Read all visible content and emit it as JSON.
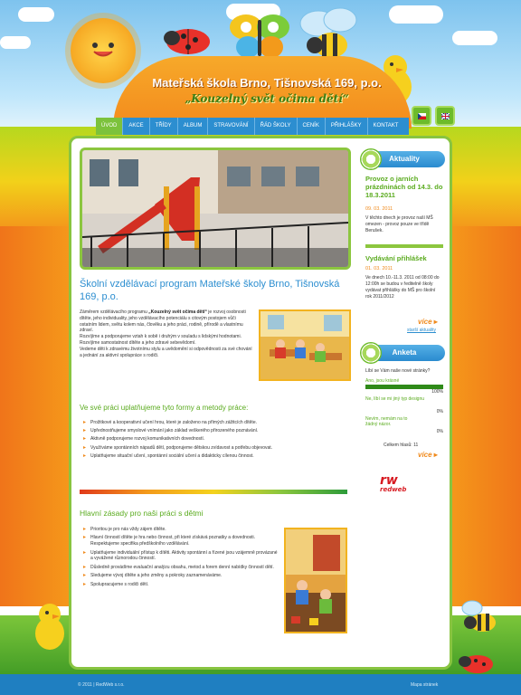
{
  "header": {
    "title": "Mateřská škola Brno, Tišnovská 169, p.o.",
    "motto": "„Kouzelný svět očima dětí“"
  },
  "nav": {
    "items": [
      "ÚVOD",
      "AKCE",
      "TŘÍDY",
      "ALBUM",
      "STRAVOVÁNÍ",
      "ŘÁD ŠKOLY",
      "CENÍK",
      "PŘIHLÁŠKY",
      "KONTAKT"
    ],
    "active": "ÚVOD"
  },
  "main": {
    "heading": "Školní vzdělávací program Mateřské školy Brno, Tišnovská 169, p.o.",
    "intro": {
      "lead": "Záměrem vzdělávacího programu ",
      "program": "„Kouzelný svět očima dětí“",
      "rest": " je rozvoj osobnosti dítěte, jeho individuality, jeho vzdělávacího potenciálu s citovým postojem vůči ostatním lidem, světu kolem nás, člověku a jeho práci, rodině, přírodě a vlastnímu zdraví.",
      "lines": [
        "Rozvíjíme a podporujeme vztah k sobě i druhým v souladu s lidskými hodnotami.",
        "Rozvíjíme samostatnost dítěte a jeho zdravé sebevědomí.",
        "Vedeme děti k zdravému životnímu stylu a uvědomění si odpovědnosti za své chování a jednání za aktivní spolupráce s rodiči."
      ]
    },
    "methods": {
      "heading": "Ve své práci uplatňujeme tyto formy a metody práce:",
      "items": [
        "Prožitkové a kooperativní učení hrou, které je založeno na přímých zážitcích dítěte.",
        "Upřednostňujeme smyslové vnímání jako základ veškerého přirozeného poznávání.",
        "Aktivně podporujeme rozvoj komunikativních dovedností.",
        "Využíváme spontánních nápadů dětí, podporujeme dětskou zvídavost a potřebu objevovat.",
        "Uplatňujeme situační učení, spontánní sociální učení a didakticky cílenou činnost."
      ]
    },
    "principles": {
      "heading": "Hlavní zásady pro naši práci s dětmi",
      "items": [
        "Prioritou je pro nás vždy zájem dítěte.",
        "Hlavní činností dítěte je hra nebo činnost, při které získává poznatky a dovednosti. Respektujeme specifika předškolního vzdělávání.",
        "Uplatňujeme individuální přístup k dítěti. Aktivity spontánní a řízené jsou vzájemně provázané a vyvážené různorodou činností.",
        "Důsledně provádíme evaluační analýzu obsahu, metod a forem denní nabídky činností dětí.",
        "Sledujeme vývoj dítěte a jeho změny a pokroky zaznamenáváme.",
        "Spolupracujeme s rodiči dětí."
      ]
    }
  },
  "sidebar": {
    "news_heading": "Aktuality",
    "news": [
      {
        "title": "Provoz o jarních prázdninách od 14.3. do 18.3.2011",
        "date": "09. 03. 2011",
        "text": "V těchto dnech je provoz naší MŠ omezen - provoz pouze ve třídě Berušek."
      },
      {
        "title": "Vydávání přihlášek",
        "date": "01. 03. 2011",
        "text": "Ve dnech 10.-11.3. 2011 od 08:00 do 12:00h se budou v ředitelně školy vydávat přihlášky do MŠ pro školní rok 2011/2012"
      }
    ],
    "more_label": "více",
    "archive_label": "starší aktuality",
    "poll_heading": "Anketa",
    "poll": {
      "question": "Líbí se Vám naše nové stránky?",
      "options": [
        {
          "label": "Ano, jsou krásné",
          "percent_label": "100%",
          "percent": 100
        },
        {
          "label": "Ne, líbí se mi jiný typ designu",
          "percent_label": "0%",
          "percent": 0
        },
        {
          "label": "Nevím, nemám na to žádný názor.",
          "percent_label": "0%",
          "percent": 0
        }
      ],
      "total_label": "Celkem hlasů: 11"
    },
    "poll_more_label": "více",
    "partner_logo": {
      "mark": "rw",
      "word": "redweb"
    }
  },
  "footer": {
    "copyright": "© 2011 | RedWeb s.r.o.",
    "sitemap": "Mapa stránek"
  },
  "icons": [
    "sun-icon",
    "ladybug-icon",
    "butterfly-icon",
    "bee-icon",
    "chick-icon",
    "flag-cz-icon",
    "flag-en-icon"
  ],
  "colors": {
    "accent_blue": "#2c8ed0",
    "accent_green": "#5aab1e",
    "accent_orange": "#f08a1c",
    "brand_red": "#d71920"
  }
}
